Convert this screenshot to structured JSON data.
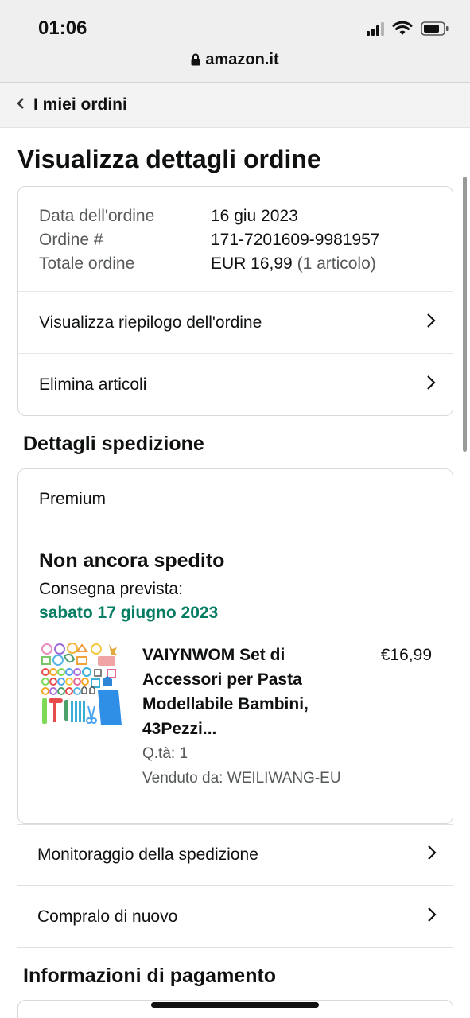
{
  "status_bar": {
    "time": "01:06"
  },
  "browser": {
    "url": "amazon.it"
  },
  "nav": {
    "back_label": "I miei ordini"
  },
  "page": {
    "title": "Visualizza dettagli ordine"
  },
  "order_summary": {
    "rows": [
      {
        "label": "Data dell'ordine",
        "value": "16 giu 2023"
      },
      {
        "label": "Ordine #",
        "value": "171-7201609-9981957"
      },
      {
        "label": "Totale ordine",
        "value": "EUR 16,99",
        "note": "(1 articolo)"
      }
    ],
    "links": [
      {
        "label": "Visualizza riepilogo dell'ordine"
      },
      {
        "label": "Elimina articoli"
      }
    ]
  },
  "shipping": {
    "section_title": "Dettagli spedizione",
    "service": "Premium",
    "status": "Non ancora spedito",
    "eta_label": "Consegna prevista:",
    "eta_date": "sabato 17 giugno 2023",
    "item": {
      "title": "VAIYNWOM Set di Accessori per Pasta Modellabile Bambini, 43Pezzi...",
      "quantity": "Q.tà: 1",
      "seller": "Venduto da: WEILIWANG-EU",
      "price": "€16,99"
    },
    "actions": [
      {
        "label": "Monitoraggio della spedizione"
      },
      {
        "label": "Compralo di nuovo"
      }
    ]
  },
  "payment": {
    "section_title": "Informazioni di pagamento"
  },
  "colors": {
    "eta_green": "#067d62",
    "muted_text": "#565959",
    "border": "#d5d9d9"
  }
}
